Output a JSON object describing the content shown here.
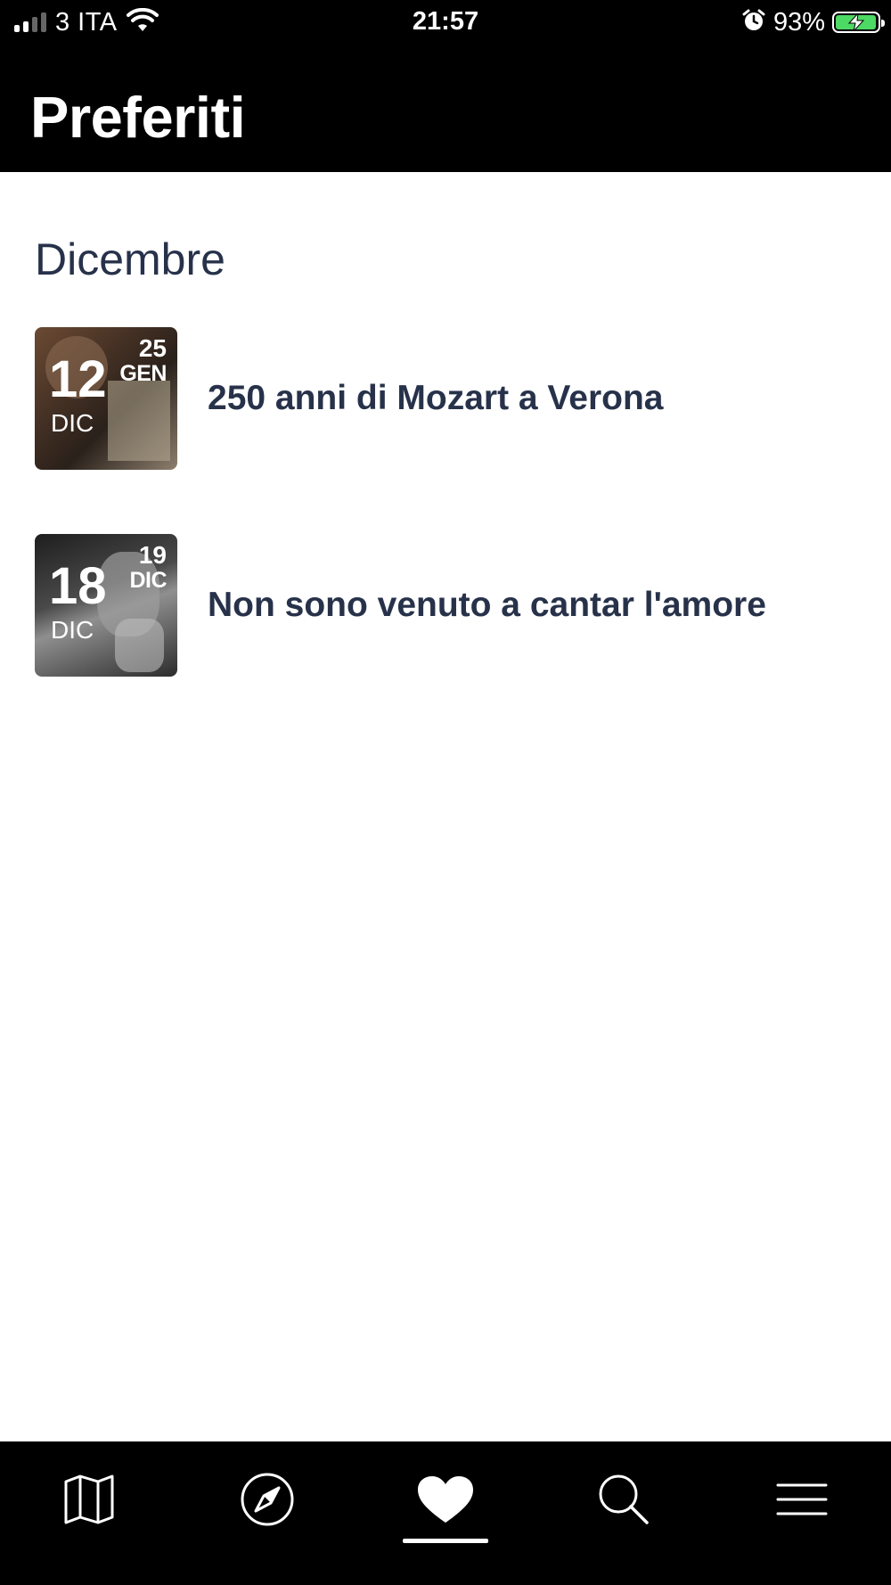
{
  "status_bar": {
    "carrier": "3 ITA",
    "time": "21:57",
    "battery_percent": "93%",
    "signal_bars_active": 2,
    "signal_bars_total": 4,
    "battery_color": "#4cd964"
  },
  "header": {
    "title": "Preferiti"
  },
  "section": {
    "title": "Dicembre"
  },
  "events": [
    {
      "title": "250 anni di Mozart a Verona",
      "start_day": "12",
      "start_month": "DIC",
      "end_day": "25",
      "end_month": "GEN"
    },
    {
      "title": "Non sono venuto a cantar l'amore",
      "start_day": "18",
      "start_month": "DIC",
      "end_day": "19",
      "end_month": "DIC"
    }
  ],
  "tab_bar": {
    "items": [
      {
        "icon": "map-icon",
        "active": false
      },
      {
        "icon": "compass-icon",
        "active": false
      },
      {
        "icon": "heart-icon",
        "active": true
      },
      {
        "icon": "search-icon",
        "active": false
      },
      {
        "icon": "menu-icon",
        "active": false
      }
    ]
  },
  "colors": {
    "header_bg": "#000000",
    "text_primary": "#27324a",
    "tab_bar_bg": "#000000"
  }
}
